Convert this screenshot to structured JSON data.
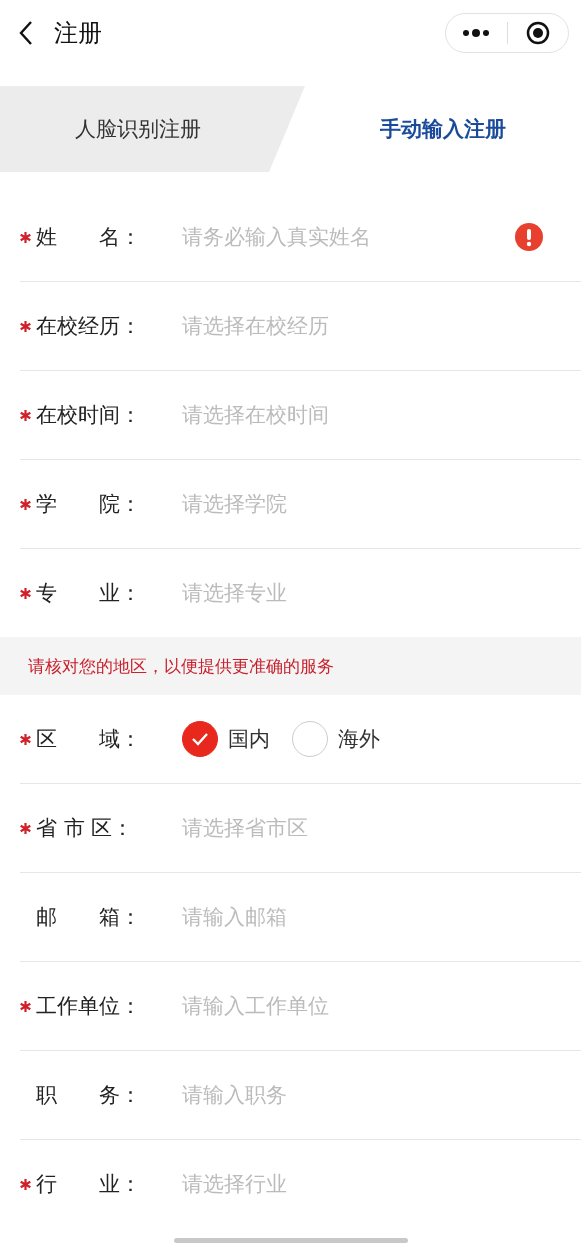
{
  "nav": {
    "title": "注册"
  },
  "tabs": [
    {
      "label": "人脸识别注册",
      "selected": false
    },
    {
      "label": "手动输入注册",
      "selected": true
    }
  ],
  "form_top": [
    {
      "kind": "input",
      "required": true,
      "label": "姓　　名：",
      "placeholder": "请务必输入真实姓名",
      "error": true
    },
    {
      "kind": "input",
      "required": true,
      "label": "在校经历：",
      "placeholder": "请选择在校经历",
      "error": false
    },
    {
      "kind": "input",
      "required": true,
      "label": "在校时间：",
      "placeholder": "请选择在校时间",
      "error": false
    },
    {
      "kind": "input",
      "required": true,
      "label": "学　　院：",
      "placeholder": "请选择学院",
      "error": false
    },
    {
      "kind": "input",
      "required": true,
      "label": "专　　业：",
      "placeholder": "请选择专业",
      "error": false
    }
  ],
  "notice": "请核对您的地区，以便提供更准确的服务",
  "form_bottom": [
    {
      "kind": "radio",
      "required": true,
      "label": "区　　域：",
      "options": [
        {
          "label": "国内",
          "selected": true
        },
        {
          "label": "海外",
          "selected": false
        }
      ]
    },
    {
      "kind": "input",
      "required": true,
      "label": "省 市 区：",
      "placeholder": "请选择省市区",
      "error": false
    },
    {
      "kind": "input",
      "required": false,
      "label": "邮　　箱：",
      "placeholder": "请输入邮箱",
      "error": false
    },
    {
      "kind": "input",
      "required": true,
      "label": "工作单位：",
      "placeholder": "请输入工作单位",
      "error": false
    },
    {
      "kind": "input",
      "required": false,
      "label": "职　　务：",
      "placeholder": "请输入职务",
      "error": false
    },
    {
      "kind": "input",
      "required": true,
      "label": "行　　业：",
      "placeholder": "请选择行业",
      "error": false
    }
  ]
}
